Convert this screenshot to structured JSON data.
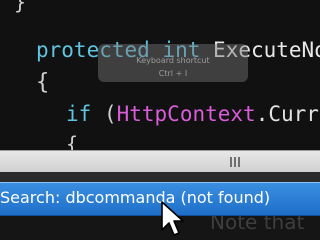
{
  "code": {
    "line0": "}",
    "line1_kw1": "protected",
    "line1_kw2": "int",
    "line1_rest": "ExecuteNonQ",
    "line2": "{",
    "line3_kw": "if",
    "line3_paren": "(",
    "line3_ctx": "HttpContext",
    "line3_rest": ".Current.",
    "line4": "{"
  },
  "shortcut_popup": {
    "title": "Keyboard shortcut",
    "keys": "Ctrl + I"
  },
  "search": {
    "text": "Search: dbcommanda (not found)"
  },
  "background_note": "Note that",
  "colors": {
    "keyword": "#5ec4e0",
    "context_type": "#d95cd9",
    "search_bar": "#2a7fd8"
  },
  "icons": {
    "cursor": "mouse-pointer-icon",
    "grip": "resize-grip-icon"
  }
}
